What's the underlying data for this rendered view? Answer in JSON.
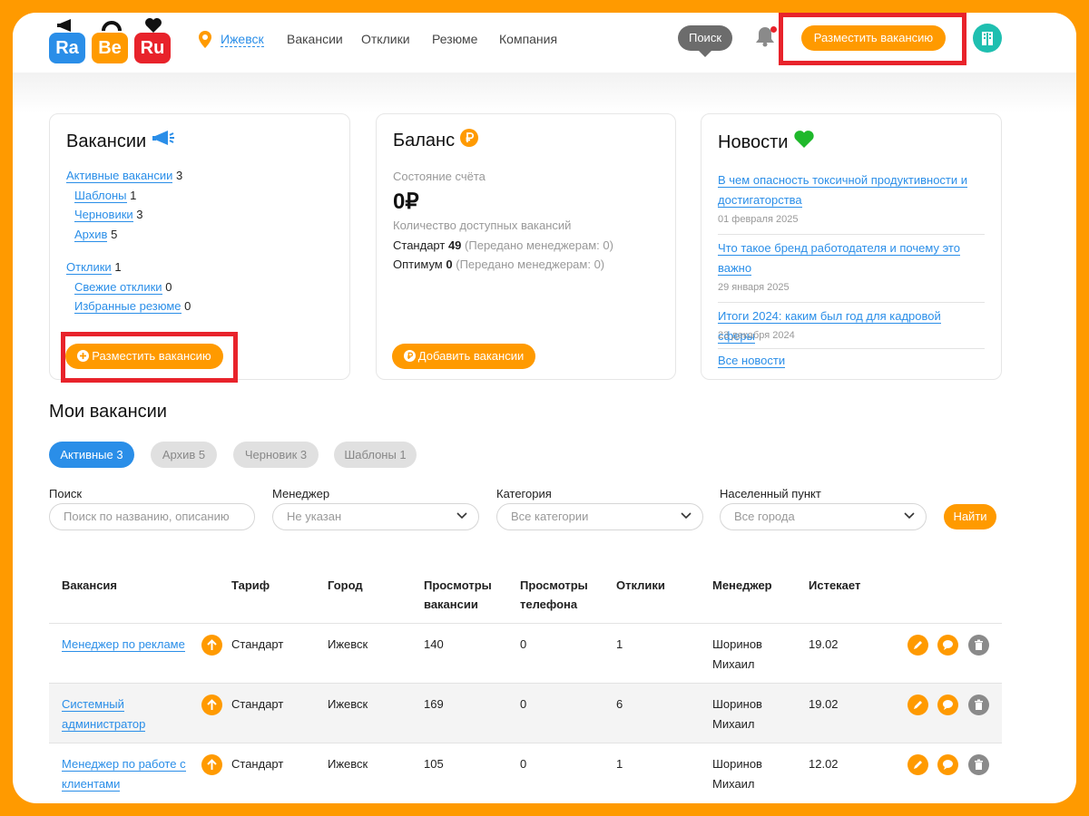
{
  "logo": {
    "tiles": [
      "Ra",
      "Be",
      "Ru"
    ]
  },
  "header": {
    "city": "Ижевск",
    "nav": [
      "Вакансии",
      "Отклики",
      "Резюме",
      "Компания"
    ],
    "search_bubble": "Поиск",
    "post_button": "Разместить вакансию"
  },
  "cards": {
    "vacancies": {
      "title": "Вакансии",
      "items": [
        {
          "label": "Активные вакансии",
          "count": "3"
        },
        {
          "label": "Шаблоны",
          "count": "1"
        },
        {
          "label": "Черновики",
          "count": "3"
        },
        {
          "label": "Архив",
          "count": "5"
        },
        {
          "label": "Отклики",
          "count": "1"
        },
        {
          "label": "Свежие отклики",
          "count": "0"
        },
        {
          "label": "Избранные резюме",
          "count": "0"
        }
      ],
      "button": "Разместить вакансию"
    },
    "balance": {
      "title": "Баланс",
      "state_label": "Состояние счёта",
      "amount": "0₽",
      "available_label": "Количество доступных вакансий",
      "standard_label": "Стандарт",
      "standard_count": "49",
      "standard_note": "(Передано менеджерам: 0)",
      "optimum_label": "Оптимум",
      "optimum_count": "0",
      "optimum_note": "(Передано менеджерам: 0)",
      "button": "Добавить вакансии"
    },
    "news": {
      "title": "Новости",
      "items": [
        {
          "title": "В чем опасность токсичной продуктивности и достигаторства",
          "date": "01 февраля 2025"
        },
        {
          "title": "Что такое бренд работодателя и почему это важно",
          "date": "29 января 2025"
        },
        {
          "title": "Итоги 2024: каким был год для кадровой сферы",
          "date": "23 декабря 2024"
        }
      ],
      "all_link": "Все новости"
    }
  },
  "my_vacancies": {
    "title": "Мои вакансии",
    "tabs": [
      "Активные 3",
      "Архив 5",
      "Черновик 3",
      "Шаблоны 1"
    ],
    "filters": {
      "search_label": "Поиск",
      "search_placeholder": "Поиск по названию, описанию",
      "manager_label": "Менеджер",
      "manager_value": "Не указан",
      "category_label": "Категория",
      "category_value": "Все категории",
      "city_label": "Населенный пункт",
      "city_value": "Все города",
      "find_button": "Найти"
    },
    "columns": {
      "vacancy": "Вакансия",
      "tariff": "Тариф",
      "city": "Город",
      "views_1": "Просмотры",
      "views_2": "вакансии",
      "phone_1": "Просмотры",
      "phone_2": "телефона",
      "responses": "Отклики",
      "manager": "Менеджер",
      "expires": "Истекает"
    },
    "rows": [
      {
        "vac_1": "Менеджер по рекламе",
        "vac_2": "",
        "tariff": "Стандарт",
        "city": "Ижевск",
        "views": "140",
        "phone": "0",
        "responses": "1",
        "manager_1": "Шоринов",
        "manager_2": "Михаил",
        "expires": "19.02"
      },
      {
        "vac_1": "Системный",
        "vac_2": "администратор",
        "tariff": "Стандарт",
        "city": "Ижевск",
        "views": "169",
        "phone": "0",
        "responses": "6",
        "manager_1": "Шоринов",
        "manager_2": "Михаил",
        "expires": "19.02"
      },
      {
        "vac_1": "Менеджер по работе с",
        "vac_2": "клиентами",
        "tariff": "Стандарт",
        "city": "Ижевск",
        "views": "105",
        "phone": "0",
        "responses": "1",
        "manager_1": "Шоринов",
        "manager_2": "Михаил",
        "expires": "12.02"
      }
    ]
  },
  "colors": {
    "accent": "#ff9a00",
    "link": "#2a8ee8",
    "highlight": "#e8232b",
    "logo_blue": "#2a8ee8",
    "logo_red": "#e8232b"
  },
  "icons": [
    "location-pin-icon",
    "bell-icon",
    "company-avatar-icon",
    "megaphone-icon",
    "ruble-coin-icon",
    "heart-icon",
    "plus-circle-icon",
    "chevron-down-icon",
    "arrow-up-icon",
    "edit-icon",
    "chat-icon",
    "trash-icon"
  ]
}
